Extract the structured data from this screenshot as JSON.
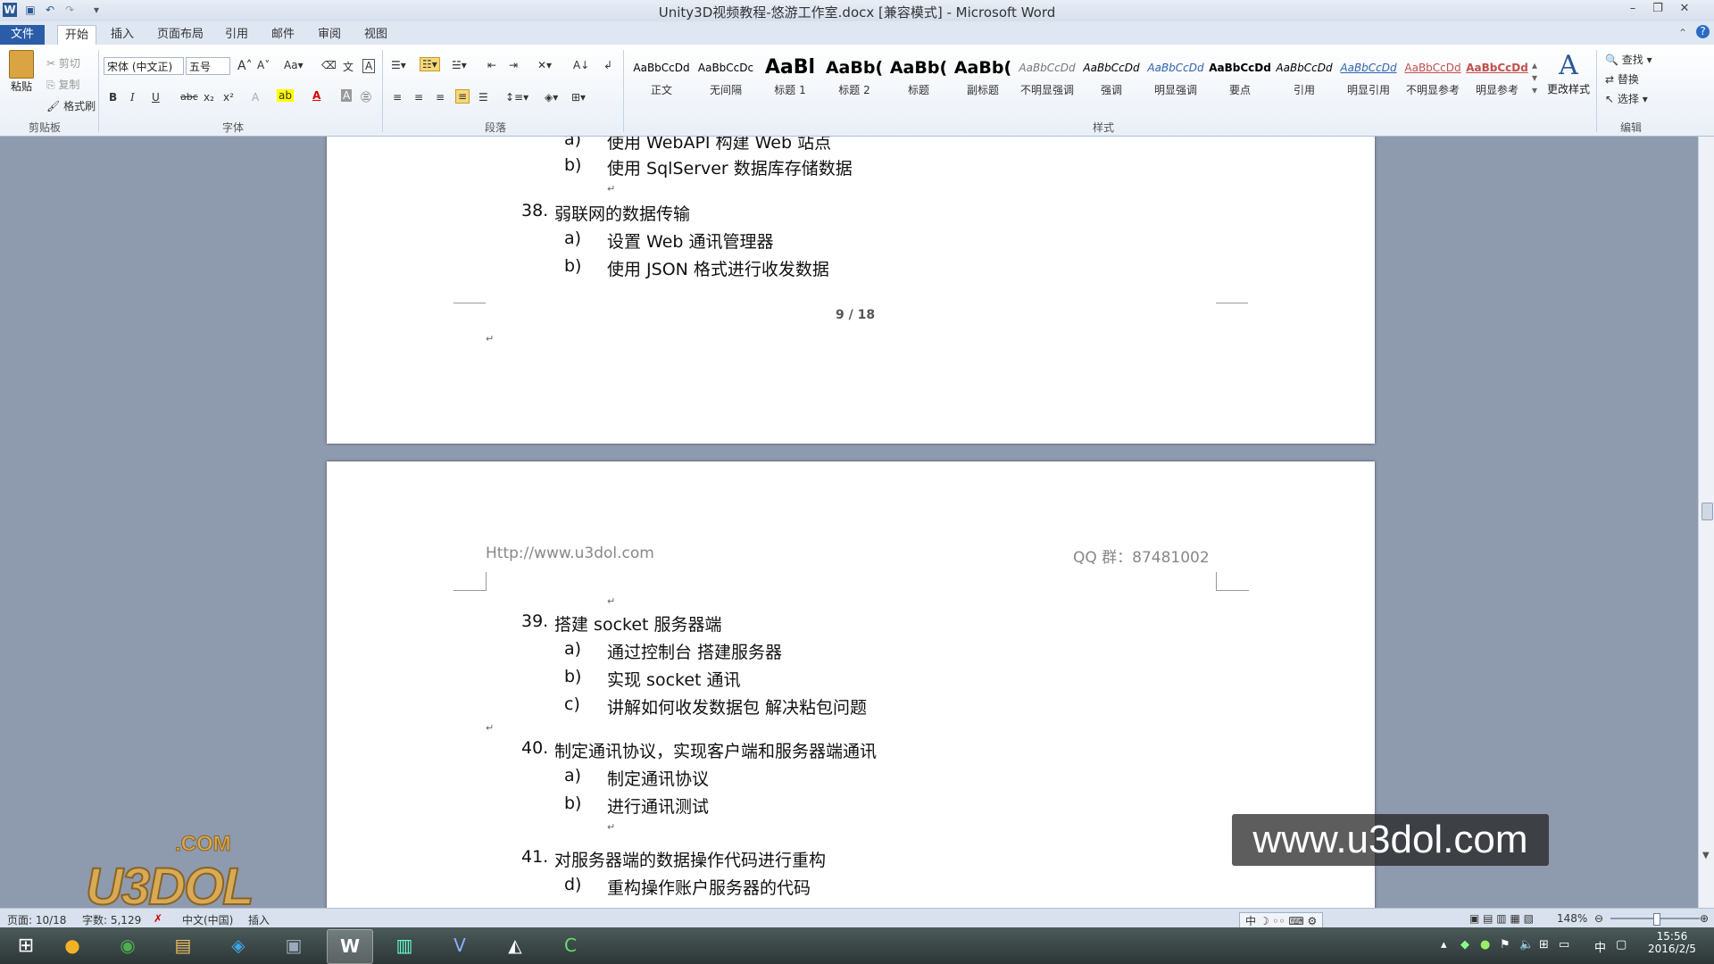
{
  "window": {
    "title": "Unity3D视频教程-悠游工作室.docx [兼容模式] - Microsoft Word",
    "qat_icons": [
      "word-icon",
      "save-icon",
      "undo-icon",
      "redo-icon",
      "customize-icon"
    ]
  },
  "tabs": [
    "文件",
    "开始",
    "插入",
    "页面布局",
    "引用",
    "邮件",
    "审阅",
    "视图"
  ],
  "active_tab": "开始",
  "clipboard": {
    "paste": "粘贴",
    "cut": "剪切",
    "copy": "复制",
    "format_painter": "格式刷",
    "label": "剪贴板"
  },
  "font": {
    "name": "宋体 (中文正)",
    "size": "五号",
    "label": "字体",
    "buttons": [
      "B",
      "I",
      "U",
      "abc",
      "x₂",
      "x²"
    ]
  },
  "paragraph": {
    "label": "段落"
  },
  "styles": {
    "label": "样式",
    "items": [
      {
        "sample": "AaBbCcDd",
        "name": "正文"
      },
      {
        "sample": "AaBbCcDc",
        "name": "无间隔"
      },
      {
        "sample": "AaBl",
        "name": "标题 1"
      },
      {
        "sample": "AaBb(",
        "name": "标题 2"
      },
      {
        "sample": "AaBb(",
        "name": "标题"
      },
      {
        "sample": "AaBb(",
        "name": "副标题"
      },
      {
        "sample": "AaBbCcDd",
        "name": "不明显强调"
      },
      {
        "sample": "AaBbCcDd",
        "name": "强调"
      },
      {
        "sample": "AaBbCcDd",
        "name": "明显强调"
      },
      {
        "sample": "AaBbCcDd",
        "name": "要点"
      },
      {
        "sample": "AaBbCcDd",
        "name": "引用"
      },
      {
        "sample": "AaBbCcDd",
        "name": "明显引用"
      },
      {
        "sample": "AaBbCcDd",
        "name": "不明显参考"
      },
      {
        "sample": "AaBbCcDd",
        "name": "明显参考"
      }
    ],
    "change_styles": "更改样式"
  },
  "editing": {
    "label": "编辑",
    "find": "查找",
    "replace": "替换",
    "select": "选择"
  },
  "page1": {
    "line_a_label": "a)",
    "line_a_text": "使用 WebAPI 构建 Web 站点",
    "line_b_label": "b)",
    "line_b_text": "使用 SqlServer 数据库存储数据",
    "item38_num": "38.",
    "item38_text": "弱联网的数据传输",
    "item38_a_label": "a)",
    "item38_a": "设置 Web 通讯管理器",
    "item38_b_label": "b)",
    "item38_b": "使用 JSON 格式进行收发数据",
    "footer": "9 / 18"
  },
  "page2": {
    "header_left": "Http://www.u3dol.com",
    "header_right": "QQ 群：87481002",
    "item39_num": "39.",
    "item39_text": "搭建 socket 服务器端",
    "item39_a_label": "a)",
    "item39_a": "通过控制台 搭建服务器",
    "item39_b_label": "b)",
    "item39_b": "实现 socket 通讯",
    "item39_c_label": "c)",
    "item39_c": "讲解如何收发数据包 解决粘包问题",
    "item40_num": "40.",
    "item40_text": "制定通讯协议，实现客户端和服务器端通讯",
    "item40_a_label": "a)",
    "item40_a": "制定通讯协议",
    "item40_b_label": "b)",
    "item40_b": "进行通讯测试",
    "item41_num": "41.",
    "item41_text": "对服务器端的数据操作代码进行重构",
    "item41_d_label": "d)",
    "item41_d": "重构操作账户服务器的代码"
  },
  "status": {
    "page": "页面: 10/18",
    "words": "字数: 5,129",
    "language": "中文(中国)",
    "mode": "插入",
    "zoom": "148%"
  },
  "watermark": "www.u3dol.com",
  "logo_text": "U3DOL",
  "logo_sub": ".COM",
  "taskbar": {
    "time": "15:56",
    "date": "2016/2/5",
    "ime": "中"
  }
}
